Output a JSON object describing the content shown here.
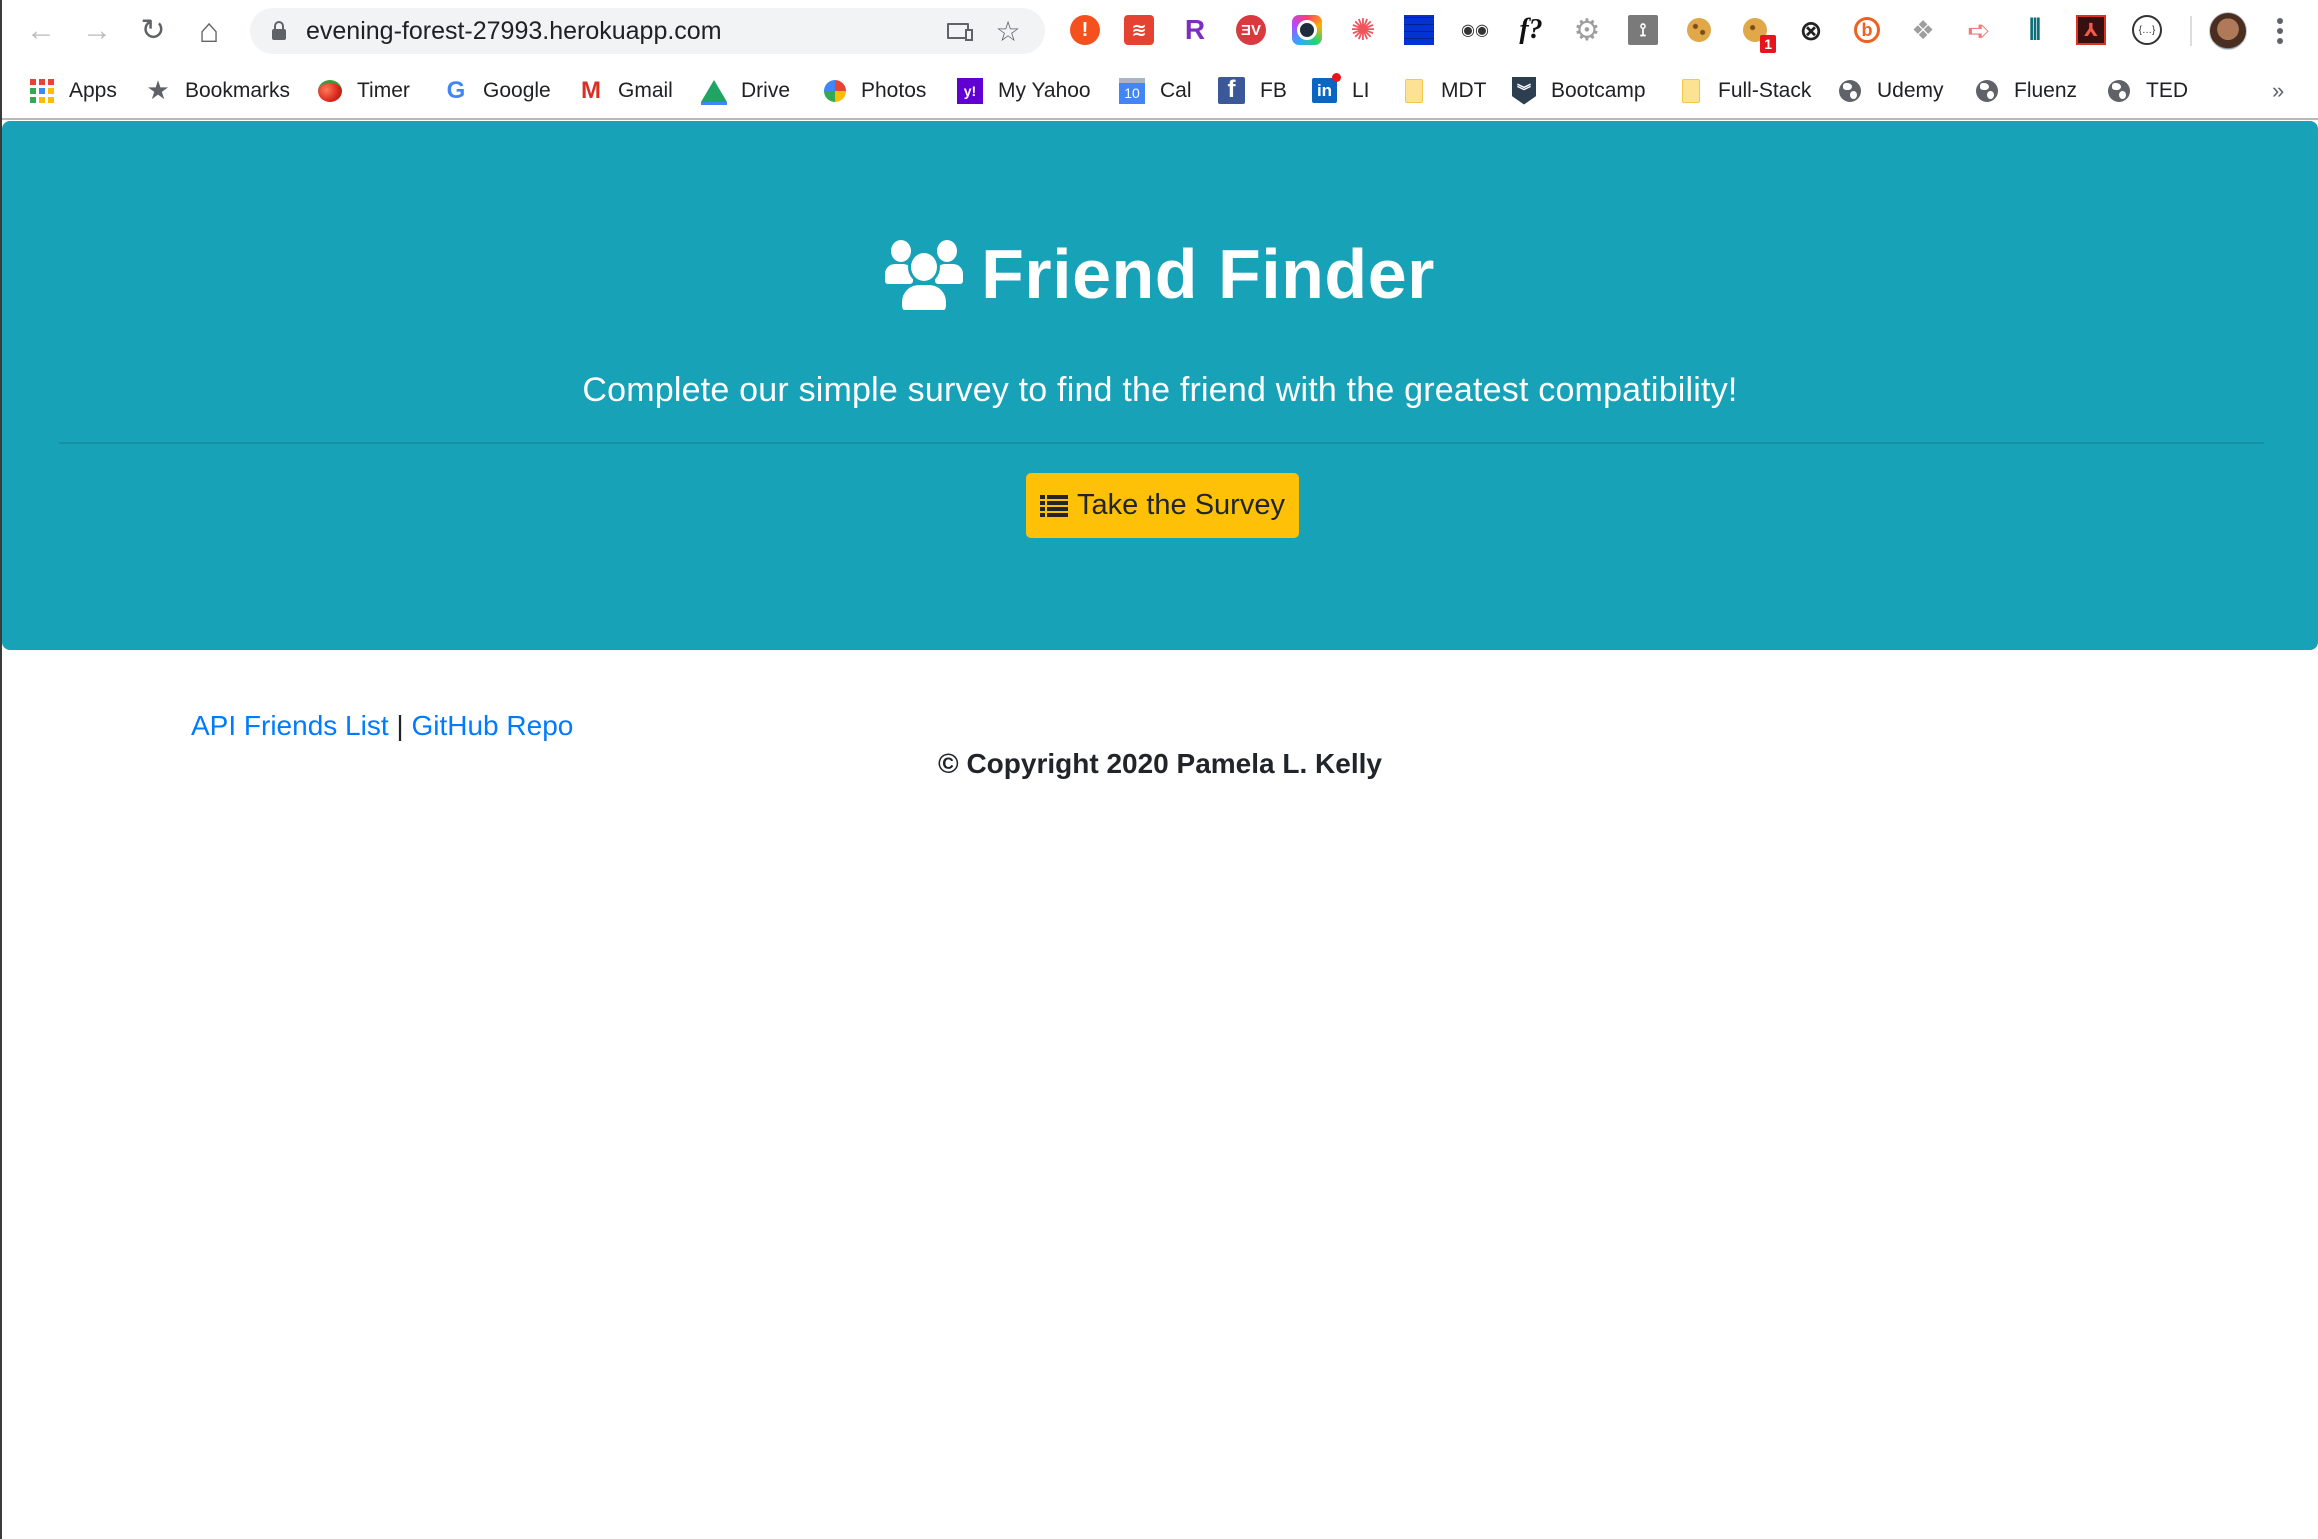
{
  "browser": {
    "url": "evening-forest-27993.herokuapp.com",
    "nav": {
      "back": "←",
      "forward": "→",
      "reload": "↻",
      "home": "⌂",
      "star": "☆"
    },
    "extensions": [
      {
        "name": "alert-extension",
        "glyph": "!",
        "color": "#f4511e"
      },
      {
        "name": "todoist-extension",
        "glyph": "≋",
        "color": "#e44332"
      },
      {
        "name": "rakuten-extension",
        "glyph": "R",
        "color": "#7b2fbe"
      },
      {
        "name": "expressvpn-extension",
        "glyph": "ƎV",
        "color": "#da3940"
      },
      {
        "name": "screen-recorder-extension",
        "glyph": "●",
        "color": "#1f1f2e"
      },
      {
        "name": "spiral-extension",
        "glyph": "✺",
        "color": "#f0545d"
      },
      {
        "name": "grid-extension",
        "glyph": "▦",
        "color": "#1a73e8"
      },
      {
        "name": "incognito-extension",
        "glyph": "◉◉",
        "color": "#333333"
      },
      {
        "name": "whatfont-extension",
        "glyph": "f?",
        "color": "#111111"
      },
      {
        "name": "settings-extension",
        "glyph": "⚙",
        "color": "#9e9e9e"
      },
      {
        "name": "hubspot-extension",
        "glyph": "⟟",
        "color": "#7a7a7a"
      },
      {
        "name": "cookie-extension",
        "glyph": "●",
        "color": "#d9a441"
      },
      {
        "name": "cookie-editor-extension",
        "glyph": "●",
        "color": "#d9a441",
        "badge": "1"
      },
      {
        "name": "zoom-search-extension",
        "glyph": "⊗",
        "color": "#222222"
      },
      {
        "name": "bitly-extension",
        "glyph": "b",
        "color": "#ee6123"
      },
      {
        "name": "dropbox-extension",
        "glyph": "❖",
        "color": "#9e9e9e"
      },
      {
        "name": "cast-arrow-extension",
        "glyph": "➪",
        "color": "#f07a7a"
      },
      {
        "name": "dashlane-extension",
        "glyph": "⫴",
        "color": "#0e6e78"
      },
      {
        "name": "acrobat-extension",
        "glyph": "⅄",
        "color": "#3a0f0f"
      },
      {
        "name": "json-formatter-extension",
        "glyph": "{…}",
        "color": "#333333"
      }
    ]
  },
  "bookmarks": [
    {
      "label": "Apps",
      "icon": "apps-grid-icon"
    },
    {
      "label": "Bookmarks",
      "icon": "star-icon"
    },
    {
      "label": "Timer",
      "icon": "tomato-icon"
    },
    {
      "label": "Google",
      "icon": "google-icon"
    },
    {
      "label": "Gmail",
      "icon": "gmail-icon"
    },
    {
      "label": "Drive",
      "icon": "drive-icon"
    },
    {
      "label": "Photos",
      "icon": "photos-icon"
    },
    {
      "label": "My Yahoo",
      "icon": "yahoo-icon"
    },
    {
      "label": "Cal",
      "icon": "calendar-icon",
      "icon_text": "10"
    },
    {
      "label": "FB",
      "icon": "facebook-icon",
      "icon_text": "f"
    },
    {
      "label": "LI",
      "icon": "linkedin-icon",
      "icon_text": "in"
    },
    {
      "label": "MDT",
      "icon": "folder-icon"
    },
    {
      "label": "Bootcamp",
      "icon": "shield-chevron-icon"
    },
    {
      "label": "Full-Stack",
      "icon": "folder-icon"
    },
    {
      "label": "Udemy",
      "icon": "globe-icon"
    },
    {
      "label": "Fluenz",
      "icon": "globe-icon"
    },
    {
      "label": "TED",
      "icon": "globe-icon"
    }
  ],
  "bookmarks_overflow": "»",
  "page": {
    "title": "Friend Finder",
    "subtitle": "Complete our simple survey to find the friend with the greatest compatibility!",
    "survey_button": "Take the Survey",
    "links": {
      "api": "API Friends List",
      "separator": "|",
      "github": "GitHub Repo"
    },
    "copyright": "© Copyright 2020 Pamela L. Kelly"
  },
  "colors": {
    "jumbotron": "#17a2b8",
    "button": "#ffc107",
    "link": "#007bff",
    "text": "#212529"
  }
}
